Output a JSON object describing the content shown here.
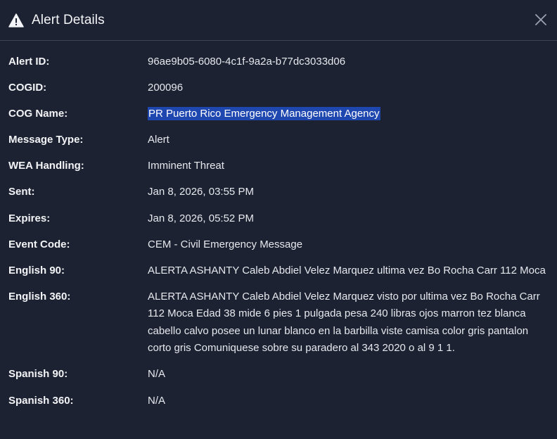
{
  "dialog": {
    "title": "Alert Details",
    "icon": "warning-icon",
    "close_icon": "close-icon"
  },
  "fields": [
    {
      "label": "Alert ID:",
      "value": "96ae9b05-6080-4c1f-9a2a-b77dc3033d06"
    },
    {
      "label": "COGID:",
      "value": "200096"
    },
    {
      "label": "COG Name:",
      "value": "PR Puerto Rico Emergency Management Agency",
      "selected": true
    },
    {
      "label": "Message Type:",
      "value": "Alert"
    },
    {
      "label": "WEA Handling:",
      "value": "Imminent Threat"
    },
    {
      "label": "Sent:",
      "value": "Jan 8, 2026, 03:55 PM"
    },
    {
      "label": "Expires:",
      "value": "Jan 8, 2026, 05:52 PM"
    },
    {
      "label": "Event Code:",
      "value": "CEM - Civil Emergency Message"
    },
    {
      "label": "English 90:",
      "value": "ALERTA ASHANTY Caleb Abdiel Velez Marquez ultima vez Bo Rocha Carr 112 Moca"
    },
    {
      "label": "English 360:",
      "value": "ALERTA ASHANTY Caleb Abdiel Velez Marquez visto por ultima vez Bo Rocha Carr 112 Moca Edad 38 mide 6 pies 1 pulgada pesa 240 libras ojos marron tez blanca cabello calvo posee un lunar blanco en la barbilla viste camisa color gris pantalon corto gris Comuniquese sobre su paradero al 343 2020 o al 9 1 1."
    },
    {
      "label": "Spanish 90:",
      "value": "N/A"
    },
    {
      "label": "Spanish 360:",
      "value": "N/A"
    }
  ],
  "colors": {
    "background": "#1c2231",
    "selection": "#1f47b0"
  }
}
